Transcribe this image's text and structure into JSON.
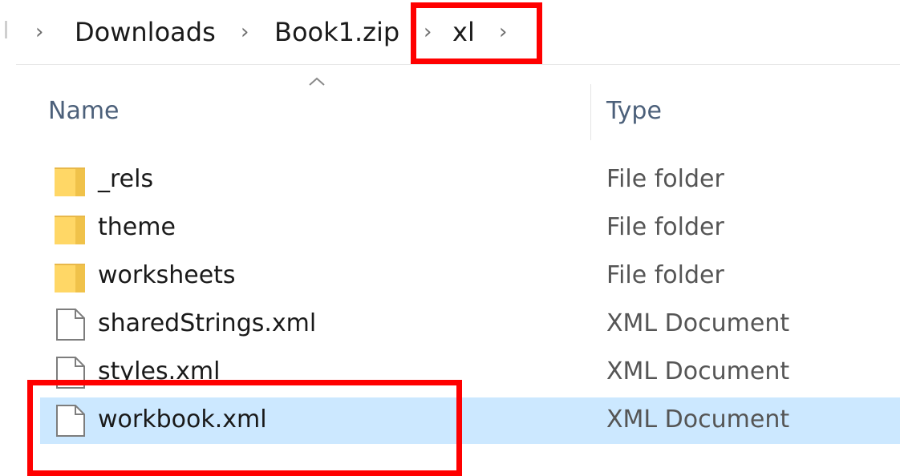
{
  "breadcrumb": {
    "items": [
      {
        "label": "Downloads"
      },
      {
        "label": "Book1.zip"
      },
      {
        "label": "xl"
      }
    ]
  },
  "columns": {
    "name": "Name",
    "type": "Type",
    "sort": "ascending"
  },
  "files": [
    {
      "name": "_rels",
      "type": "File folder",
      "icon": "folder-icon",
      "selected": false
    },
    {
      "name": "theme",
      "type": "File folder",
      "icon": "folder-icon",
      "selected": false
    },
    {
      "name": "worksheets",
      "type": "File folder",
      "icon": "folder-icon",
      "selected": false
    },
    {
      "name": "sharedStrings.xml",
      "type": "XML Document",
      "icon": "document-icon",
      "selected": false
    },
    {
      "name": "styles.xml",
      "type": "XML Document",
      "icon": "document-icon",
      "selected": false
    },
    {
      "name": "workbook.xml",
      "type": "XML Document",
      "icon": "document-icon",
      "selected": true
    }
  ],
  "colors": {
    "selection": "#cce8ff",
    "annotation": "#ff0000",
    "folder": "#ffd766",
    "header_text": "#4c607a"
  }
}
